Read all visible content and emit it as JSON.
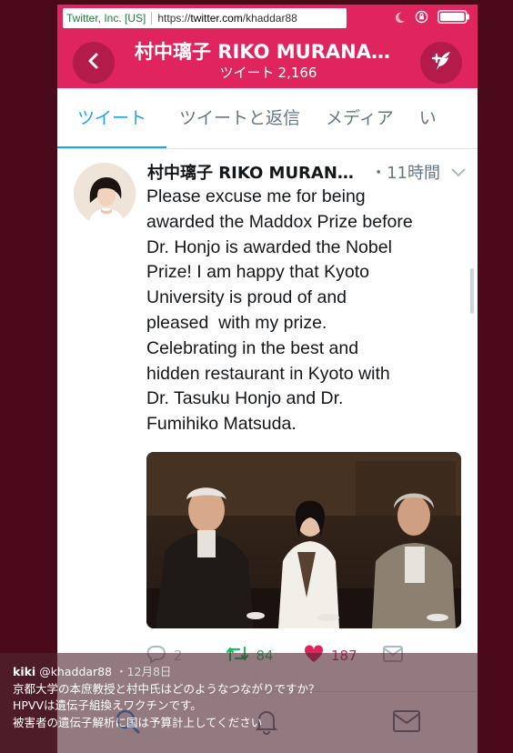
{
  "browser": {
    "site_label": "Twitter, Inc. [US]",
    "url_prefix": "https://",
    "url_host": "twitter.com",
    "url_path": "/khaddar88"
  },
  "header": {
    "title": "村中璃子  RIKO MURANAKA",
    "tweets_label": "ツイート",
    "tweets_count": "2,166",
    "color": "#e0245e"
  },
  "tabs": [
    {
      "label": "ツイート",
      "active": true
    },
    {
      "label": "ツイートと返信",
      "active": false
    },
    {
      "label": "メディア",
      "active": false
    },
    {
      "label": "い",
      "active": false
    }
  ],
  "tweet": {
    "name": "村中璃子  RIKO MURANAKA",
    "time": "・11時間",
    "text": "Please excuse me for being\nawarded the Maddox Prize before\nDr. Honjo is awarded the Nobel\nPrize! I am happy that Kyoto\nUniversity is proud of and\npleased  with my prize.\nCelebrating in the best and\nhidden restaurant in Kyoto with\nDr. Tasuku Honjo and Dr.\nFumihiko Matsuda.",
    "replies": "2",
    "retweets": "84",
    "likes": "187"
  },
  "caption": {
    "user": "kiki",
    "handle": "@khaddar88",
    "date": "・12月8日",
    "lines": [
      "京都大学の本庶教授と村中氏はどのようなつながりですか？",
      "HPVVは遺伝子組換えワクチンです。",
      "被害者の遺伝子解析に国は予算計上してください"
    ]
  },
  "colors": {
    "accent": "#1da1f2",
    "retweet": "#17bf63",
    "like": "#e0245e",
    "background": "#4a0a1a"
  }
}
